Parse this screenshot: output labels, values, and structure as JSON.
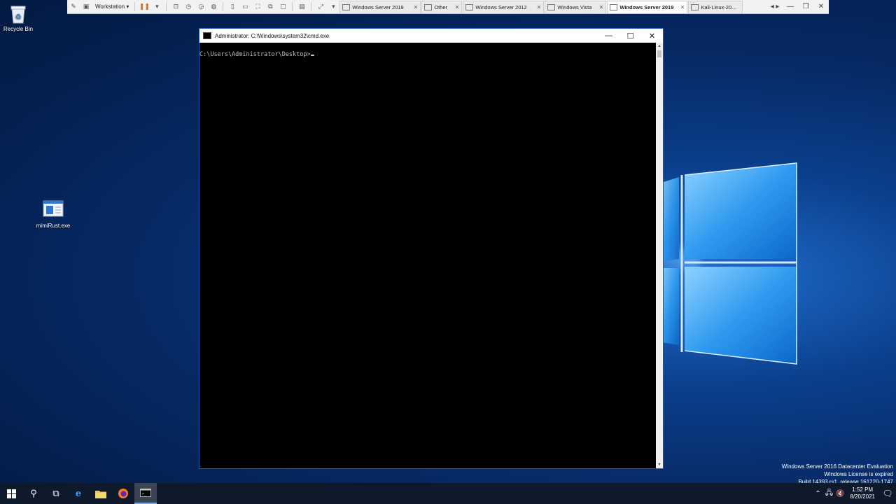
{
  "vmware": {
    "workstation_label": "Workstation",
    "tabs": [
      {
        "label": "Windows Server 2019",
        "active": false
      },
      {
        "label": "Other",
        "active": false
      },
      {
        "label": "Windows Server 2012",
        "active": false
      },
      {
        "label": "Windows Vista",
        "active": false
      },
      {
        "label": "Windows Server 2019",
        "active": true
      },
      {
        "label": "Kali-Linux-20...",
        "active": false
      }
    ]
  },
  "desktop": {
    "recycle_bin": "Recycle Bin",
    "file_icon": "mimiRust.exe"
  },
  "cmd": {
    "title": "Administrator: C:\\Windows\\system32\\cmd.exe",
    "prompt": "C:\\Users\\Administrator\\Desktop>",
    "controls": {
      "minimize": "—",
      "maximize": "☐",
      "close": "✕"
    }
  },
  "watermark": {
    "line1": "Windows Server 2016 Datacenter Evaluation",
    "line2": "Windows License is expired",
    "line3": "Build 14393.rs1_release.161220-1747"
  },
  "taskbar": {
    "time": "1:52 PM",
    "date": "8/20/2021"
  },
  "colors": {
    "accent": "#1e5bb5",
    "console_text": "#c0c0c0",
    "taskbar": "#0e1a2b"
  }
}
